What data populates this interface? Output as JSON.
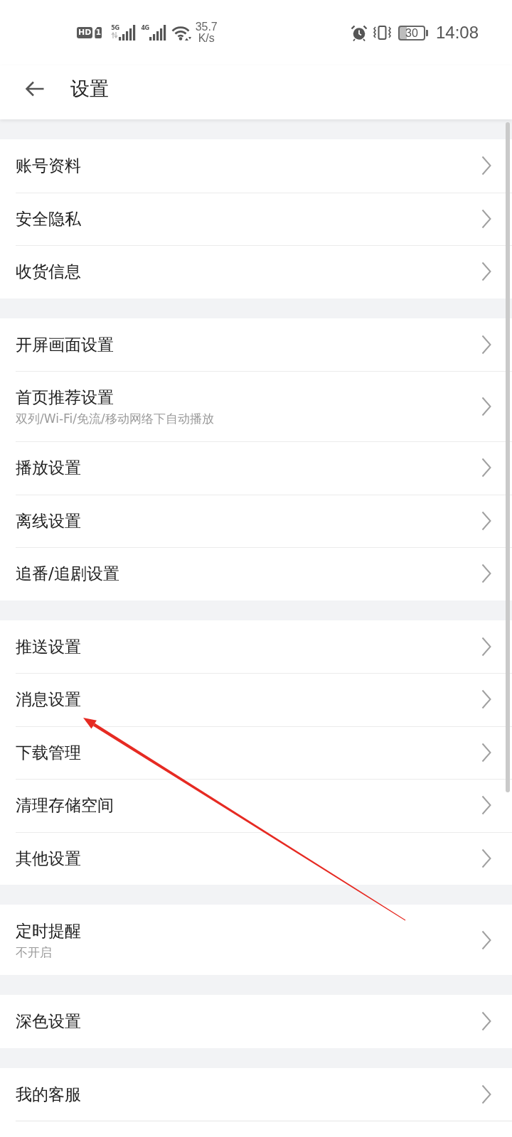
{
  "status_bar": {
    "hd_badge": "HD",
    "sim_badge": "1",
    "networks": [
      {
        "label": "5G",
        "activity": true
      },
      {
        "label": "4G",
        "activity": false
      }
    ],
    "speed_value": "35.7",
    "speed_unit": "K/s",
    "battery": "30",
    "time": "14:08"
  },
  "header": {
    "title": "设置"
  },
  "groups": [
    {
      "items": [
        {
          "label": "账号资料"
        },
        {
          "label": "安全隐私"
        },
        {
          "label": "收货信息"
        }
      ]
    },
    {
      "items": [
        {
          "label": "开屏画面设置"
        },
        {
          "label": "首页推荐设置",
          "subtitle": "双列/Wi-Fi/免流/移动网络下自动播放"
        },
        {
          "label": "播放设置"
        },
        {
          "label": "离线设置"
        },
        {
          "label": "追番/追剧设置"
        }
      ]
    },
    {
      "items": [
        {
          "label": "推送设置"
        },
        {
          "label": "消息设置"
        },
        {
          "label": "下载管理"
        },
        {
          "label": "清理存储空间"
        },
        {
          "label": "其他设置"
        }
      ]
    },
    {
      "items": [
        {
          "label": "定时提醒",
          "subtitle": "不开启"
        }
      ]
    },
    {
      "items": [
        {
          "label": "深色设置"
        }
      ]
    },
    {
      "items": [
        {
          "label": "我的客服"
        }
      ]
    }
  ],
  "annotations": [
    {
      "kind": "arrow"
    }
  ]
}
